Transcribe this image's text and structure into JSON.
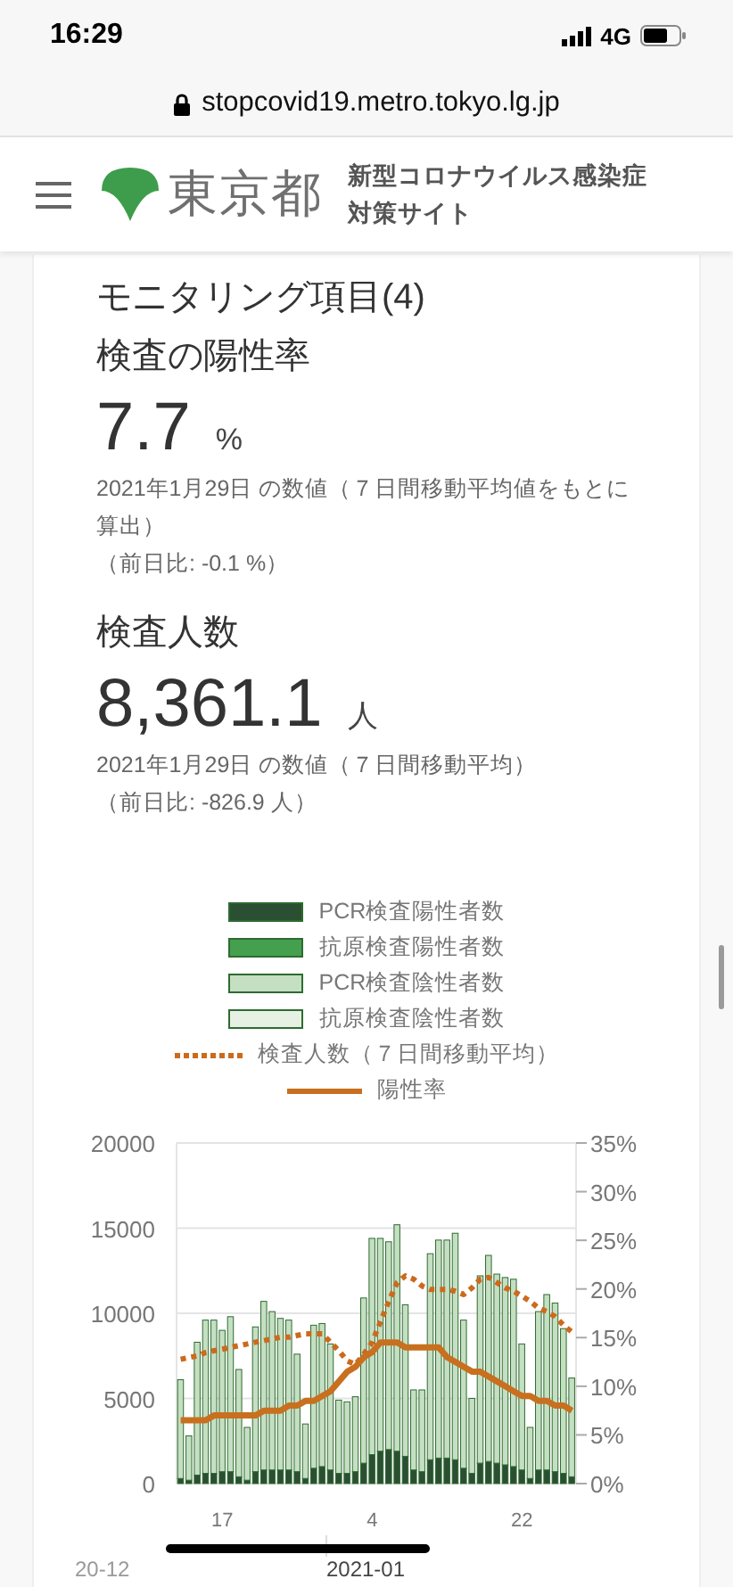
{
  "status_bar": {
    "time": "16:29",
    "network": "4G"
  },
  "browser": {
    "url": "stopcovid19.metro.tokyo.lg.jp"
  },
  "header": {
    "logo_text": "東京都",
    "title_lines": [
      "新型コロナウイルス感染症",
      "対策サイト"
    ]
  },
  "card": {
    "heading": "モニタリング項目(4)",
    "metrics": [
      {
        "title": "検査の陽性率",
        "value": "7.7",
        "unit": "%",
        "note": "2021年1月29日 の数値（７日間移動平均値をもとに算出）",
        "change": "（前日比: -0.1 %）"
      },
      {
        "title": "検査人数",
        "value": "8,361.1",
        "unit": "人",
        "note": "2021年1月29日 の数値（７日間移動平均）",
        "change": "（前日比: -826.9 人）"
      }
    ]
  },
  "chart": {
    "month_labels": [
      "20-12",
      "2021-01"
    ],
    "chart_data": {
      "type": "bar",
      "stacked": true,
      "grid": true,
      "categories": [
        null,
        null,
        null,
        null,
        null,
        "17",
        null,
        null,
        null,
        null,
        null,
        null,
        null,
        null,
        null,
        null,
        null,
        null,
        null,
        null,
        null,
        null,
        null,
        "4",
        null,
        null,
        null,
        null,
        null,
        null,
        null,
        null,
        null,
        null,
        null,
        null,
        null,
        null,
        null,
        null,
        null,
        "22",
        null,
        null,
        null,
        null,
        null,
        null
      ],
      "ylim": [
        0,
        20000
      ],
      "yticks": [
        0,
        5000,
        10000,
        15000,
        20000
      ],
      "y2lim": [
        0,
        35
      ],
      "y2ticks": [
        {
          "value": 0,
          "label": "0%"
        },
        {
          "value": 5,
          "label": "5%"
        },
        {
          "value": 10,
          "label": "10%"
        },
        {
          "value": 15,
          "label": "15%"
        },
        {
          "value": 20,
          "label": "20%"
        },
        {
          "value": 25,
          "label": "25%"
        },
        {
          "value": 30,
          "label": "30%"
        },
        {
          "value": 35,
          "label": "35%"
        }
      ],
      "series": [
        {
          "name": "PCR検査陽性者数",
          "type": "bar",
          "color": "#2b4f32",
          "values": [
            300,
            200,
            500,
            600,
            600,
            700,
            700,
            400,
            200,
            700,
            800,
            800,
            800,
            800,
            700,
            300,
            900,
            1000,
            800,
            600,
            600,
            700,
            1200,
            1700,
            1900,
            2000,
            1900,
            1600,
            800,
            700,
            1400,
            1500,
            1500,
            1400,
            900,
            600,
            1200,
            1300,
            1200,
            1100,
            1000,
            800,
            300,
            800,
            800,
            700,
            600,
            400
          ]
        },
        {
          "name": "抗原検査陽性者数",
          "type": "bar",
          "color": "#44a04f",
          "values": [
            0,
            0,
            0,
            0,
            0,
            0,
            0,
            0,
            0,
            0,
            0,
            0,
            0,
            0,
            0,
            0,
            0,
            0,
            0,
            0,
            0,
            0,
            0,
            0,
            0,
            0,
            0,
            0,
            0,
            0,
            0,
            0,
            0,
            0,
            0,
            0,
            0,
            0,
            0,
            0,
            0,
            0,
            0,
            0,
            0,
            0,
            0,
            0
          ]
        },
        {
          "name": "PCR検査陰性者数",
          "type": "bar",
          "color": "#c5dfc2",
          "values": [
            5800,
            2600,
            7800,
            9000,
            9000,
            8300,
            9100,
            6300,
            3100,
            8500,
            9900,
            9300,
            8900,
            8800,
            6900,
            3200,
            8400,
            8400,
            7400,
            4300,
            4200,
            4400,
            9700,
            12700,
            12500,
            12200,
            13300,
            8900,
            4700,
            4800,
            12100,
            12800,
            12800,
            13300,
            8700,
            4400,
            11000,
            12100,
            11100,
            11000,
            11000,
            7400,
            3000,
            9300,
            10300,
            9900,
            8500,
            5800
          ]
        },
        {
          "name": "抗原検査陰性者数",
          "type": "bar",
          "color": "#e6f0e3",
          "values": [
            0,
            0,
            0,
            0,
            0,
            0,
            0,
            0,
            0,
            0,
            0,
            0,
            0,
            0,
            0,
            0,
            0,
            0,
            0,
            0,
            0,
            0,
            0,
            0,
            0,
            0,
            0,
            0,
            0,
            0,
            0,
            0,
            0,
            0,
            0,
            0,
            0,
            0,
            0,
            0,
            0,
            0,
            0,
            0,
            0,
            0,
            0,
            0
          ]
        },
        {
          "name": "検査人数（７日間移動平均）",
          "type": "line",
          "line_style": "dotted",
          "color": "#cc6a1c",
          "values": [
            7300,
            7400,
            7500,
            7700,
            7800,
            7900,
            8000,
            8100,
            8200,
            8300,
            8400,
            8500,
            8600,
            8600,
            8700,
            8800,
            8800,
            8800,
            8300,
            7800,
            7200,
            7000,
            7600,
            8300,
            9500,
            10700,
            11800,
            12200,
            12000,
            11600,
            11400,
            11400,
            11400,
            11300,
            11100,
            11500,
            12000,
            12100,
            11800,
            11500,
            11300,
            11000,
            10700,
            10300,
            10100,
            9800,
            9300,
            8900
          ]
        },
        {
          "name": "陽性率",
          "type": "line",
          "line_style": "solid",
          "axis": "y2",
          "color": "#c8701f",
          "values": [
            6.5,
            6.5,
            6.5,
            6.5,
            7,
            7,
            7,
            7,
            7,
            7,
            7.5,
            7.5,
            7.5,
            8,
            8,
            8.5,
            8.5,
            9,
            9.5,
            10.5,
            11.5,
            12,
            13,
            13.5,
            14.5,
            14.5,
            14.5,
            14,
            14,
            14,
            14,
            14,
            13,
            12.5,
            12,
            11.5,
            11.5,
            11,
            10.5,
            10,
            9.5,
            9,
            9,
            8.5,
            8.5,
            8,
            8,
            7.5
          ]
        }
      ]
    }
  }
}
